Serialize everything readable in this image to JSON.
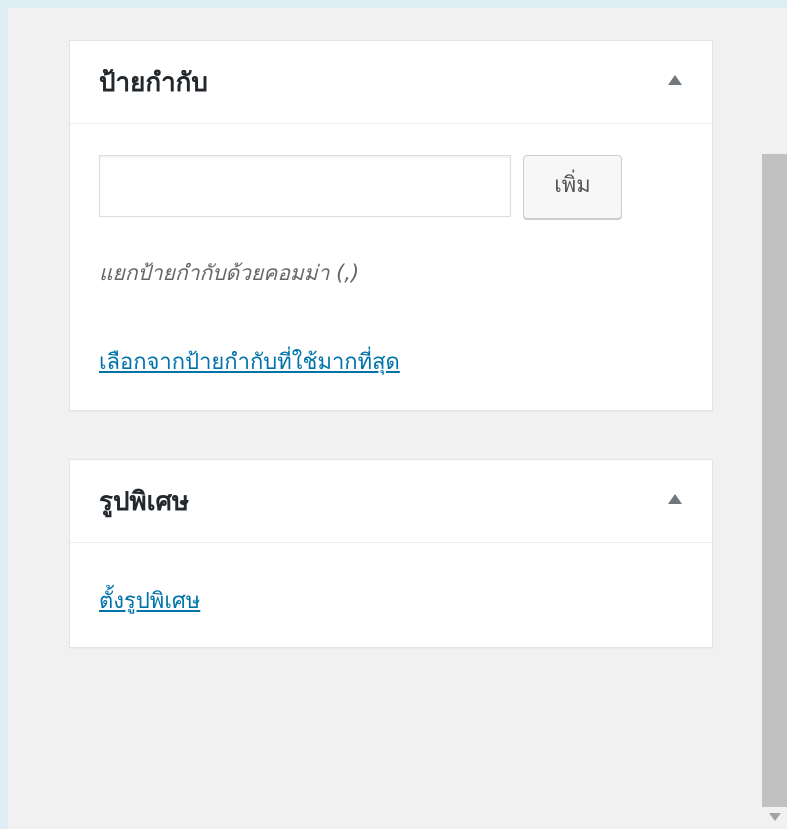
{
  "tags_box": {
    "title": "ป้ายกำกับ",
    "input_value": "",
    "add_label": "เพิ่ม",
    "hint": "แยกป้ายกำกับด้วยคอมม่า (,)",
    "popular_link": "เลือกจากป้ายกำกับที่ใช้มากที่สุด"
  },
  "thumbnail_box": {
    "title": "รูปพิเศษ",
    "set_link": "ตั้งรูปพิเศษ"
  },
  "icons": {
    "toggle": "triangle-up-icon",
    "scroll_down": "chevron-down-icon"
  },
  "colors": {
    "link": "#0073aa",
    "background": "#f1f1f1",
    "frame": "#deecf4"
  }
}
